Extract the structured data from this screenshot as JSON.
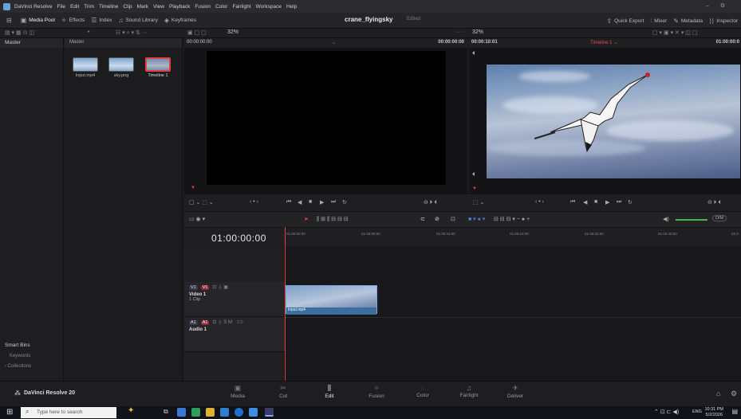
{
  "menubar": {
    "app": "DaVinci Resolve",
    "items": [
      "File",
      "Edit",
      "Trim",
      "Timeline",
      "Clip",
      "Mark",
      "View",
      "Playback",
      "Fusion",
      "Color",
      "Fairlight",
      "Workspace",
      "Help"
    ]
  },
  "toolbar": {
    "media_pool": "Media Pool",
    "effects": "Effects",
    "index": "Index",
    "sound_library": "Sound Library",
    "keyframes": "Keyframes",
    "project": "crane_flyingsky",
    "status": "Edited",
    "quick_export": "Quick Export",
    "mixer": "Mixer",
    "metadata": "Metadata",
    "inspector": "Inspector"
  },
  "subbar": {
    "zoom_left": "32%",
    "zoom_right": "32%",
    "more": "···"
  },
  "bins": {
    "header": "Master",
    "smart_bins": "Smart Bins",
    "keywords": "Keywords",
    "collections": "Collections"
  },
  "pool": {
    "header": "Master",
    "clips": [
      "input.mp4",
      "sky.png",
      "Timeline 1"
    ]
  },
  "source": {
    "tc_left": "00:00:00:00",
    "tc_right": "00:00:00:00"
  },
  "program": {
    "duration": "00:00:10:01",
    "timeline": "Timeline 1",
    "tc": "01:00:00:0"
  },
  "timeline": {
    "timecode": "01:00:00:00",
    "ruler": [
      "01:00:00:00",
      "01:00:08:00",
      "01:00:16:00",
      "01:00:24:00",
      "01:00:32:00",
      "01:00:40:00",
      "01:0"
    ],
    "dim": "DIM"
  },
  "tracks": {
    "video": {
      "tag": "V1",
      "name": "Video 1",
      "clips": "1 Clip"
    },
    "audio": {
      "tag": "A1",
      "name": "Audio 1",
      "level": "2.0"
    },
    "clip_name": "input.mp4"
  },
  "pages": [
    "Media",
    "Cut",
    "Edit",
    "Fusion",
    "Color",
    "Fairlight",
    "Deliver"
  ],
  "brand": "DaVinci Resolve 20",
  "taskbar": {
    "search": "Type here to search",
    "lang": "ENG",
    "time": "10:31 PM",
    "date": "5/2/2026"
  }
}
